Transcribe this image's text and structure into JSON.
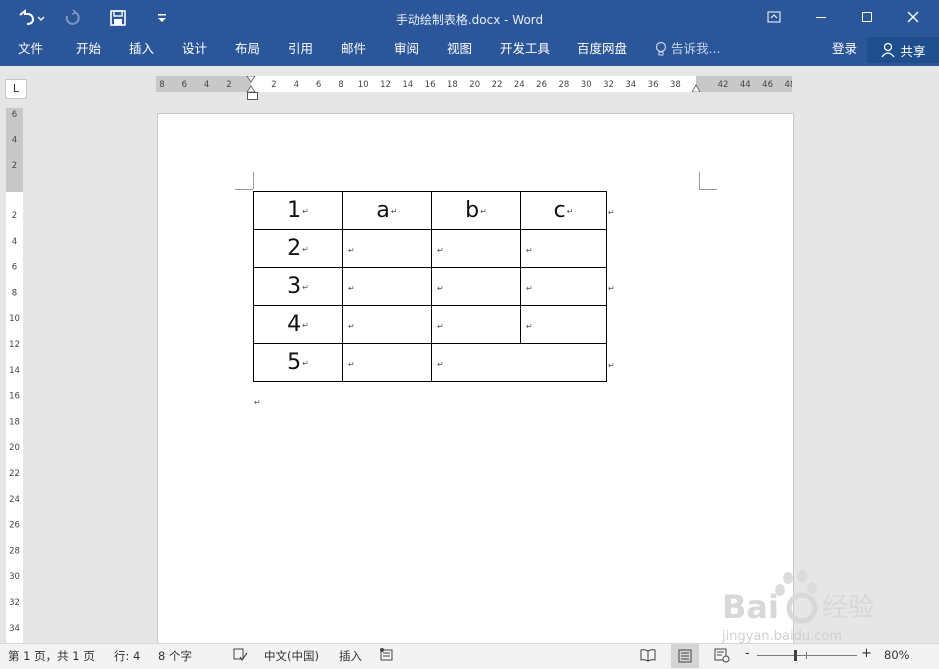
{
  "window": {
    "title": "手动绘制表格.docx - Word"
  },
  "quick_access": {
    "undo_icon": "undo-icon",
    "redo_icon": "redo-icon",
    "save_icon": "save-icon",
    "customize_icon": "customize-icon"
  },
  "window_controls": {
    "ribbon_display": "ribbon-display-icon",
    "minimize": "minimize-icon",
    "maximize": "maximize-icon",
    "close": "close-icon"
  },
  "ribbon": {
    "tabs": [
      "文件",
      "开始",
      "插入",
      "设计",
      "布局",
      "引用",
      "邮件",
      "审阅",
      "视图",
      "开发工具",
      "百度网盘"
    ],
    "tell_me": "告诉我...",
    "sign_in": "登录",
    "share": "共享"
  },
  "ruler": {
    "tab_selector": "L",
    "h_left": [
      "8",
      "6",
      "4",
      "2"
    ],
    "h_main": [
      "2",
      "4",
      "6",
      "8",
      "10",
      "12",
      "14",
      "16",
      "18",
      "20",
      "22",
      "24",
      "26",
      "28",
      "30",
      "32",
      "34",
      "36",
      "38"
    ],
    "h_right": [
      "42",
      "44",
      "46",
      "48"
    ],
    "v_top": [
      "6",
      "4",
      "2"
    ],
    "v_main": [
      "2",
      "4",
      "6",
      "8",
      "10",
      "12",
      "14",
      "16",
      "18",
      "20",
      "22",
      "24",
      "26",
      "28",
      "30",
      "32",
      "34"
    ]
  },
  "table": {
    "rows": [
      [
        "1",
        "a",
        "b",
        "c"
      ],
      [
        "2",
        "",
        "",
        ""
      ],
      [
        "3",
        "",
        "",
        ""
      ],
      [
        "4",
        "",
        "",
        ""
      ],
      [
        "5",
        "",
        ""
      ]
    ]
  },
  "status": {
    "page": "第 1 页，共 1 页",
    "line": "行: 4",
    "words": "8 个字",
    "language": "中文(中国)",
    "mode": "插入",
    "zoom": "80%",
    "zoom_minus": "-",
    "zoom_plus": "+"
  },
  "watermark": {
    "brand": "Bai",
    "brand2": "经验",
    "url": "jingyan.baidu.com"
  }
}
